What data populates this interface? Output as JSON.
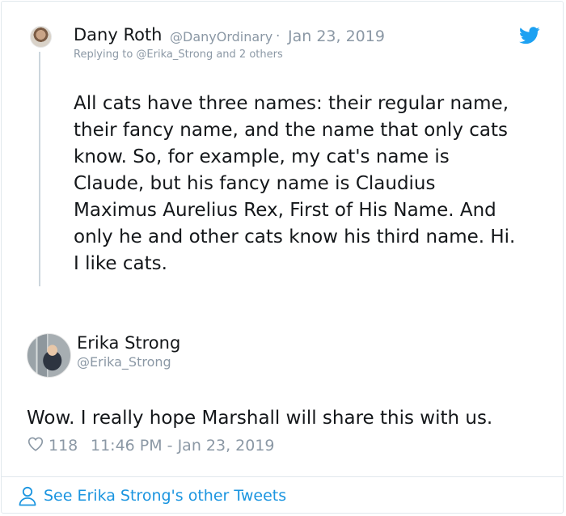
{
  "reply": {
    "name": "Dany Roth",
    "handle": "@DanyOrdinary",
    "separator": "·",
    "date": "Jan 23, 2019",
    "replying_to": "Replying to @Erika_Strong and 2 others",
    "text": "All cats have three names: their regular name,\ntheir fancy name, and the name that only cats\nknow. So, for example, my cat's name is\nClaude, but his fancy name is Claudius\nMaximus Aurelius Rex, First of His Name. And\nonly he and other cats know his third name. Hi.\nI like cats."
  },
  "tweet": {
    "name": "Erika Strong",
    "handle": "@Erika_Strong",
    "text": "Wow. I really hope Marshall will share this with us.",
    "likes": "118",
    "timestamp": "11:46 PM - Jan 23, 2019"
  },
  "footer": {
    "see_more_label": "See Erika Strong's other Tweets"
  },
  "icons": {
    "brand": "twitter-bird-icon",
    "like": "heart-icon",
    "profile": "person-icon"
  },
  "colors": {
    "text": "#14171a",
    "muted": "#8b98a5",
    "twitter_blue": "#1da1f2",
    "link_blue": "#1b95e0",
    "border": "#e1e8ed"
  }
}
